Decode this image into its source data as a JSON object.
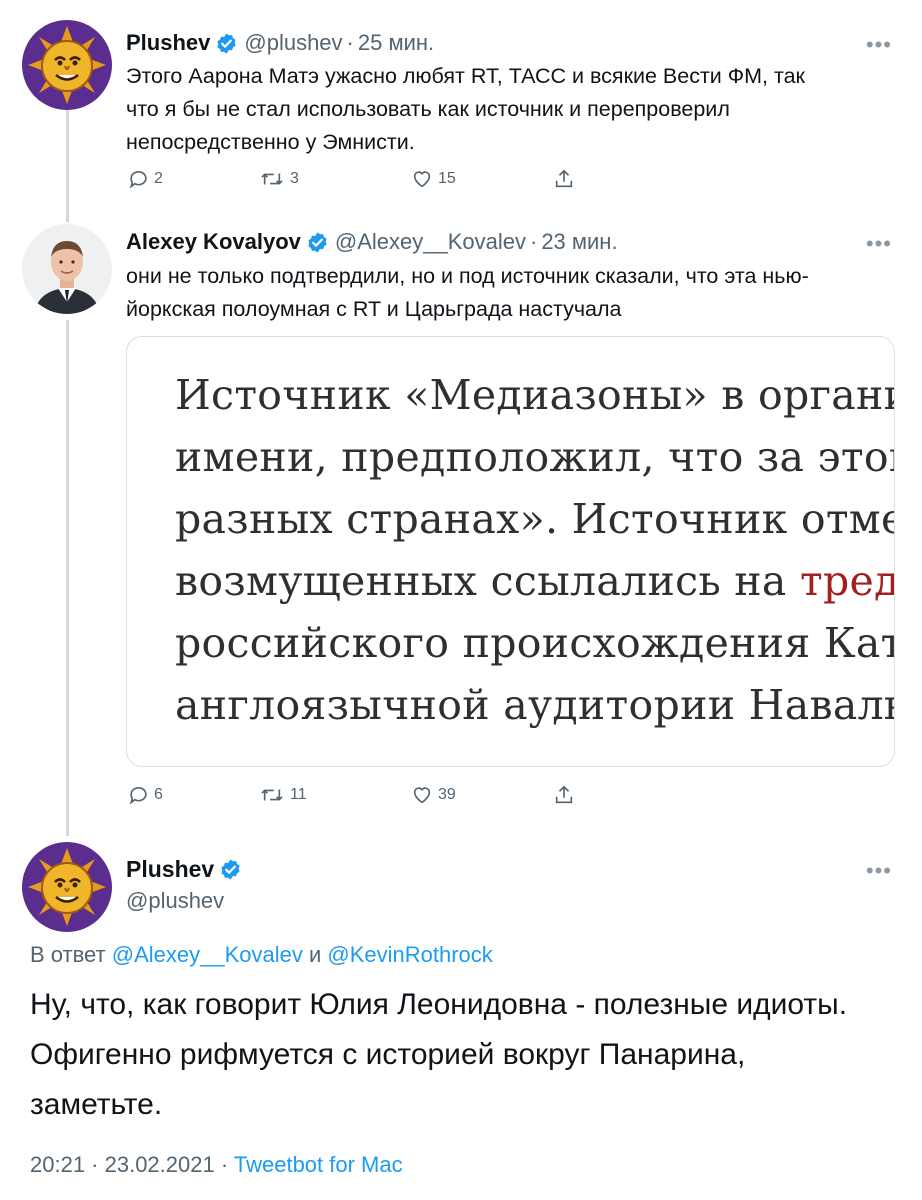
{
  "tweets": [
    {
      "name": "Plushev",
      "handle": "@plushev",
      "time": "25 мин.",
      "text_lines": [
        "Этого Аарона Матэ ужасно любят RT, ТАСС и всякие Вести ФМ, так",
        "что я бы не стал использовать как источник и перепроверил",
        "непосредственно у Эмнисти."
      ],
      "replies": "2",
      "retweets": "3",
      "likes": "15",
      "avatar_icon": "sun-cartoon-avatar"
    },
    {
      "name": "Alexey Kovalyov",
      "handle": "@Alexey__Kovalev",
      "time": "23 мин.",
      "text_lines": [
        "они не только подтвердили, но и под источник сказали, что эта нью-",
        "йоркская полоумная с RT и Царьграда настучала"
      ],
      "replies": "6",
      "retweets": "11",
      "likes": "39",
      "avatar_icon": "man-portrait-avatar"
    }
  ],
  "quote_image": {
    "lines": [
      {
        "text": "Источник «Медиазоны» в организа",
        "red": ""
      },
      {
        "text": "имени, предположил, что за этой ка",
        "red": ""
      },
      {
        "text": "разных странах». Источник отмети",
        "red": ""
      },
      {
        "text": "возмущенных ссылались на ",
        "red": "тред в т"
      },
      {
        "text": "российского происхождения Кати К",
        "red": ""
      },
      {
        "text": "англоязычной аудитории Навальнс",
        "red": ""
      }
    ]
  },
  "main_tweet": {
    "name": "Plushev",
    "handle": "@plushev",
    "reply_prefix": "В ответ ",
    "reply_mention_1": "@Alexey__Kovalev",
    "reply_and": " и ",
    "reply_mention_2": "@KevinRothrock",
    "text_lines": [
      "Ну, что, как говорит Юлия Леонидовна - полезные идиоты.",
      "Офигенно рифмуется с историей вокруг Панарина,",
      "заметьте."
    ],
    "timestamp": "20:21 · 23.02.2021 · ",
    "source": "Tweetbot for Mac"
  },
  "ui": {
    "more_label": "•••",
    "dot": "·"
  },
  "colors": {
    "verified": "#1d9bf0",
    "link": "#1d9bf0",
    "secondary": "#536471",
    "quote_red": "#a31f1f"
  }
}
